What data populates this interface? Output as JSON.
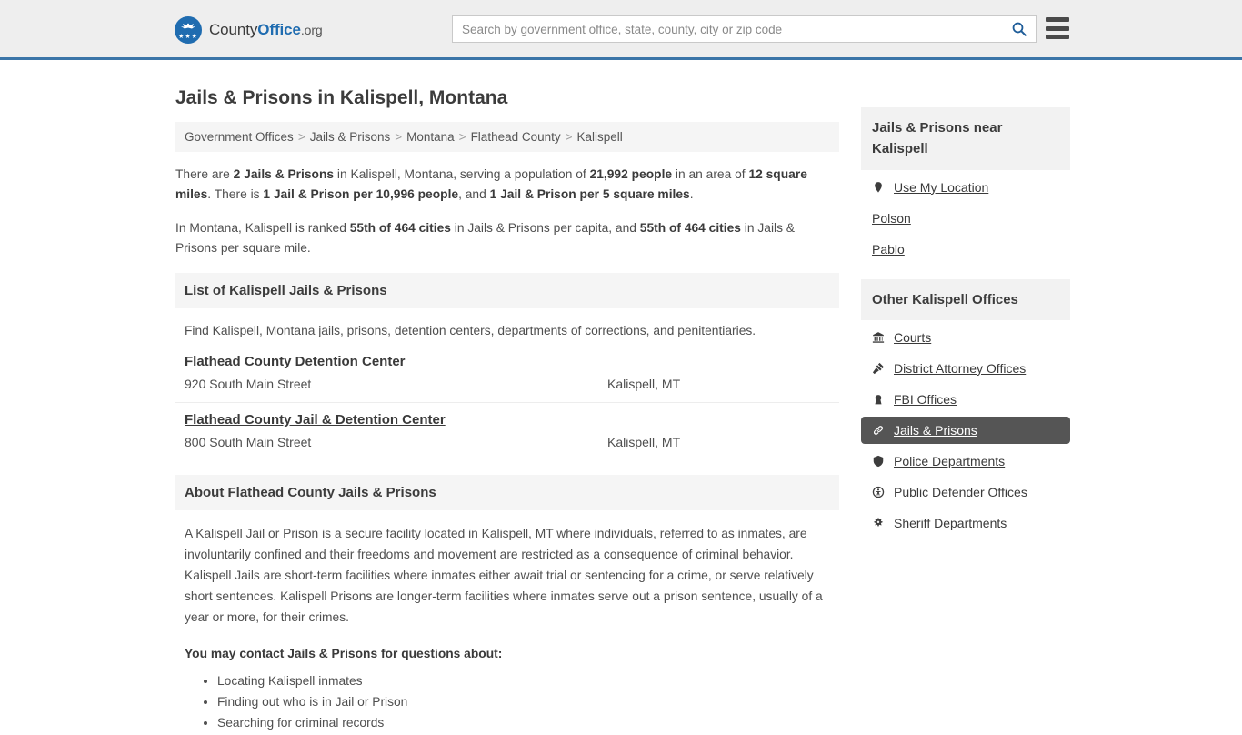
{
  "header": {
    "logo": {
      "part1": "County",
      "part2": "Office",
      "part3": ".org",
      "icon": "eagle-seal-icon"
    },
    "search": {
      "placeholder": "Search by government office, state, county, city or zip code",
      "value": "",
      "icon": "search-icon"
    },
    "menu": {
      "icon": "hamburger-menu-icon"
    },
    "accent_color": "#3b75a8"
  },
  "page_title": "Jails & Prisons in Kalispell, Montana",
  "breadcrumb": {
    "separator": ">",
    "items": [
      {
        "label": "Government Offices"
      },
      {
        "label": "Jails & Prisons"
      },
      {
        "label": "Montana"
      },
      {
        "label": "Flathead County"
      },
      {
        "label": "Kalispell"
      }
    ]
  },
  "intro": {
    "paragraph1": [
      {
        "text": "There are ",
        "bold": false
      },
      {
        "text": "2 Jails & Prisons",
        "bold": true
      },
      {
        "text": " in Kalispell, Montana, serving a population of ",
        "bold": false
      },
      {
        "text": "21,992 people",
        "bold": true
      },
      {
        "text": " in an area of ",
        "bold": false
      },
      {
        "text": "12 square miles",
        "bold": true
      },
      {
        "text": ". There is ",
        "bold": false
      },
      {
        "text": "1 Jail & Prison per 10,996 people",
        "bold": true
      },
      {
        "text": ", and ",
        "bold": false
      },
      {
        "text": "1 Jail & Prison per 5 square miles",
        "bold": true
      },
      {
        "text": ".",
        "bold": false
      }
    ],
    "paragraph2": [
      {
        "text": "In Montana, Kalispell is ranked ",
        "bold": false
      },
      {
        "text": "55th of 464 cities",
        "bold": true
      },
      {
        "text": " in Jails & Prisons per capita, and ",
        "bold": false
      },
      {
        "text": "55th of 464 cities",
        "bold": true
      },
      {
        "text": " in Jails & Prisons per square mile.",
        "bold": false
      }
    ]
  },
  "list_section": {
    "heading": "List of Kalispell Jails & Prisons",
    "subtitle": "Find Kalispell, Montana jails, prisons, detention centers, departments of corrections, and penitentiaries.",
    "listings": [
      {
        "name": "Flathead County Detention Center",
        "address": "920 South Main Street",
        "city": "Kalispell, MT"
      },
      {
        "name": "Flathead County Jail & Detention Center",
        "address": "800 South Main Street",
        "city": "Kalispell, MT"
      }
    ]
  },
  "about_section": {
    "heading": "About Flathead County Jails & Prisons",
    "body": "A Kalispell Jail or Prison is a secure facility located in Kalispell, MT where individuals, referred to as inmates, are involuntarily confined and their freedoms and movement are restricted as a consequence of criminal behavior. Kalispell Jails are short-term facilities where inmates either await trial or sentencing for a crime, or serve relatively short sentences. Kalispell Prisons are longer-term facilities where inmates serve out a prison sentence, usually of a year or more, for their crimes.",
    "contact_lead": "You may contact Jails & Prisons for questions about:",
    "contact_items": [
      "Locating Kalispell inmates",
      "Finding out who is in Jail or Prison",
      "Searching for criminal records"
    ]
  },
  "sidebar": {
    "near": {
      "heading": "Jails & Prisons near Kalispell",
      "items": [
        {
          "label": "Use My Location",
          "icon": "map-pin-icon",
          "has_icon": true
        },
        {
          "label": "Polson",
          "icon": "",
          "has_icon": false
        },
        {
          "label": "Pablo",
          "icon": "",
          "has_icon": false
        }
      ]
    },
    "other": {
      "heading": "Other Kalispell Offices",
      "active_color": "#555555",
      "items": [
        {
          "label": "Courts",
          "icon": "courthouse-icon",
          "active": false
        },
        {
          "label": "District Attorney Offices",
          "icon": "gavel-icon",
          "active": false
        },
        {
          "label": "FBI Offices",
          "icon": "fbi-badge-icon",
          "active": false
        },
        {
          "label": "Jails & Prisons",
          "icon": "chain-link-icon",
          "active": true
        },
        {
          "label": "Police Departments",
          "icon": "shield-icon",
          "active": false
        },
        {
          "label": "Public Defender Offices",
          "icon": "person-circle-icon",
          "active": false
        },
        {
          "label": "Sheriff Departments",
          "icon": "sheriff-star-icon",
          "active": false
        }
      ]
    }
  }
}
